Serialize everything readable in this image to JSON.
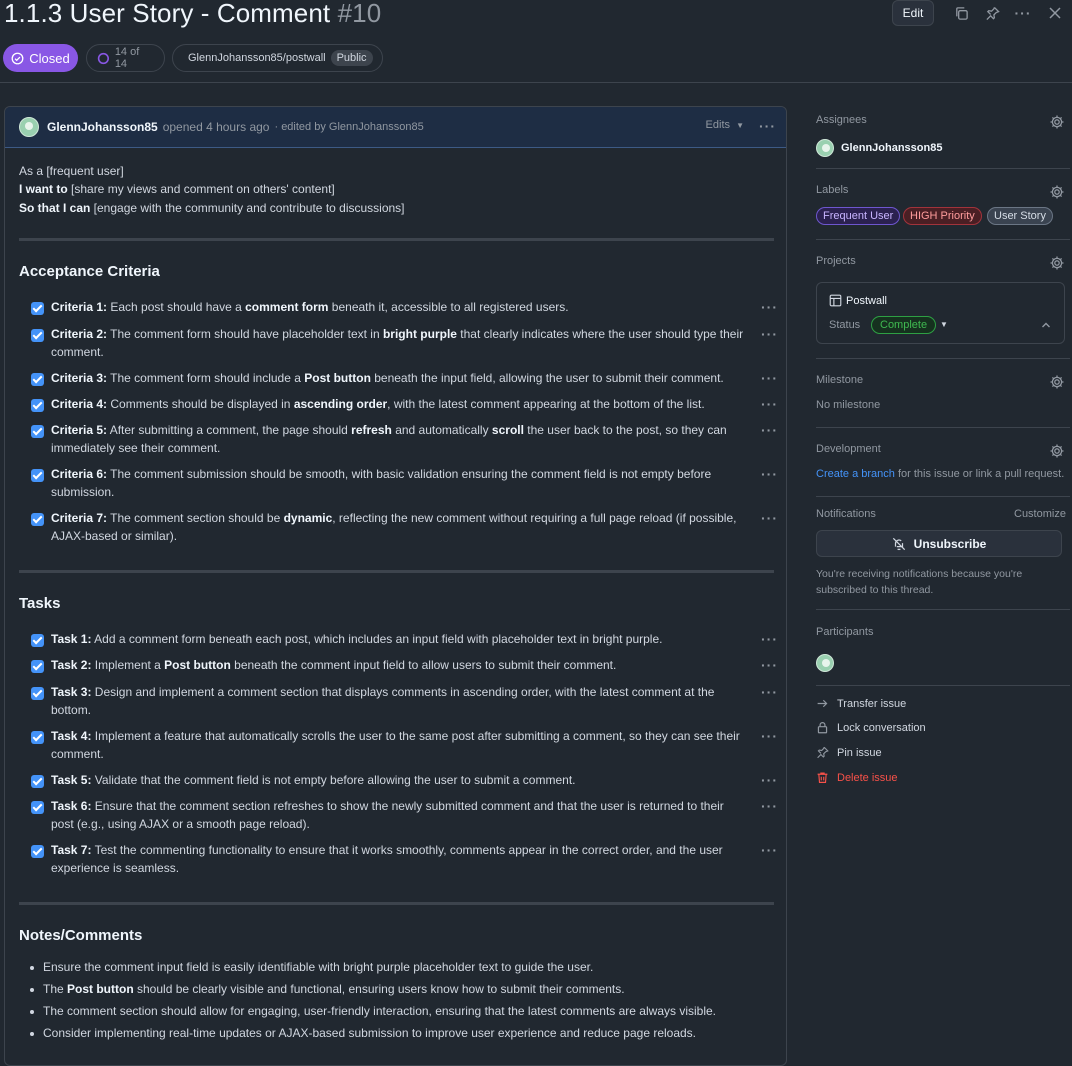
{
  "issue": {
    "title": "1.1.3 User Story - Comment",
    "number": "#10",
    "edit_label": "Edit",
    "state": "Closed",
    "progress": "14 of 14",
    "repo": "GlennJohansson85/postwall",
    "visibility": "Public"
  },
  "comment": {
    "author": "GlennJohansson85",
    "action": "opened 4 hours ago",
    "edited": "· edited by GlennJohansson85",
    "edits_label": "Edits",
    "story": [
      {
        "bold": "",
        "text": "As a [frequent user]"
      },
      {
        "bold": "I want to",
        "text": " [share my views and comment on others' content]"
      },
      {
        "bold": "So that I can",
        "text": " [engage with the community and contribute to discussions]"
      }
    ],
    "acceptance_heading": "Acceptance Criteria",
    "criteria": [
      {
        "segments": [
          [
            "b",
            "Criteria 1:"
          ],
          [
            "t",
            " Each post should have a "
          ],
          [
            "b",
            "comment form"
          ],
          [
            "t",
            " beneath it, accessible to all registered users."
          ]
        ]
      },
      {
        "segments": [
          [
            "b",
            "Criteria 2:"
          ],
          [
            "t",
            " The comment form should have placeholder text in "
          ],
          [
            "b",
            "bright purple"
          ],
          [
            "t",
            " that clearly indicates where the user should type their comment."
          ]
        ]
      },
      {
        "segments": [
          [
            "b",
            "Criteria 3:"
          ],
          [
            "t",
            " The comment form should include a "
          ],
          [
            "b",
            "Post button"
          ],
          [
            "t",
            " beneath the input field, allowing the user to submit their comment."
          ]
        ]
      },
      {
        "segments": [
          [
            "b",
            "Criteria 4:"
          ],
          [
            "t",
            " Comments should be displayed in "
          ],
          [
            "b",
            "ascending order"
          ],
          [
            "t",
            ", with the latest comment appearing at the bottom of the list."
          ]
        ]
      },
      {
        "segments": [
          [
            "b",
            "Criteria 5:"
          ],
          [
            "t",
            " After submitting a comment, the page should "
          ],
          [
            "b",
            "refresh"
          ],
          [
            "t",
            " and automatically "
          ],
          [
            "b",
            "scroll"
          ],
          [
            "t",
            " the user back to the post, so they can immediately see their comment."
          ]
        ]
      },
      {
        "segments": [
          [
            "b",
            "Criteria 6:"
          ],
          [
            "t",
            " The comment submission should be smooth, with basic validation ensuring the comment field is not empty before submission."
          ]
        ]
      },
      {
        "segments": [
          [
            "b",
            "Criteria 7:"
          ],
          [
            "t",
            " The comment section should be "
          ],
          [
            "b",
            "dynamic"
          ],
          [
            "t",
            ", reflecting the new comment without requiring a full page reload (if possible, AJAX-based or similar)."
          ]
        ]
      }
    ],
    "tasks_heading": "Tasks",
    "tasks": [
      {
        "segments": [
          [
            "b",
            "Task 1:"
          ],
          [
            "t",
            " Add a comment form beneath each post, which includes an input field with placeholder text in bright purple."
          ]
        ]
      },
      {
        "segments": [
          [
            "b",
            "Task 2:"
          ],
          [
            "t",
            " Implement a "
          ],
          [
            "b",
            "Post button"
          ],
          [
            "t",
            " beneath the comment input field to allow users to submit their comment."
          ]
        ]
      },
      {
        "segments": [
          [
            "b",
            "Task 3:"
          ],
          [
            "t",
            " Design and implement a comment section that displays comments in ascending order, with the latest comment at the bottom."
          ]
        ]
      },
      {
        "segments": [
          [
            "b",
            "Task 4:"
          ],
          [
            "t",
            " Implement a feature that automatically scrolls the user to the same post after submitting a comment, so they can see their comment."
          ]
        ]
      },
      {
        "segments": [
          [
            "b",
            "Task 5:"
          ],
          [
            "t",
            " Validate that the comment field is not empty before allowing the user to submit a comment."
          ]
        ]
      },
      {
        "segments": [
          [
            "b",
            "Task 6:"
          ],
          [
            "t",
            " Ensure that the comment section refreshes to show the newly submitted comment and that the user is returned to their post (e.g., using AJAX or a smooth page reload)."
          ]
        ]
      },
      {
        "segments": [
          [
            "b",
            "Task 7:"
          ],
          [
            "t",
            " Test the commenting functionality to ensure that it works smoothly, comments appear in the correct order, and the user experience is seamless."
          ]
        ]
      }
    ],
    "notes_heading": "Notes/Comments",
    "notes": [
      {
        "segments": [
          [
            "t",
            "Ensure the comment input field is easily identifiable with bright purple placeholder text to guide the user."
          ]
        ]
      },
      {
        "segments": [
          [
            "t",
            "The "
          ],
          [
            "b",
            "Post button"
          ],
          [
            "t",
            " should be clearly visible and functional, ensuring users know how to submit their comments."
          ]
        ]
      },
      {
        "segments": [
          [
            "t",
            "The comment section should allow for engaging, user-friendly interaction, ensuring that the latest comments are always visible."
          ]
        ]
      },
      {
        "segments": [
          [
            "t",
            "Consider implementing real-time updates or AJAX-based submission to improve user experience and reduce page reloads."
          ]
        ]
      }
    ]
  },
  "sidebar": {
    "assignees_label": "Assignees",
    "assignee": "GlennJohansson85",
    "labels_label": "Labels",
    "labels": [
      {
        "text": "Frequent User",
        "fg": "#c8b4ff",
        "bg": "#2b2150",
        "border": "#6e56cf"
      },
      {
        "text": "HIGH Priority",
        "fg": "#ff9c9c",
        "bg": "#4a1f24",
        "border": "#a2333b"
      },
      {
        "text": "User Story",
        "fg": "#d6dde6",
        "bg": "#3a4350",
        "border": "#6b7685"
      }
    ],
    "projects_label": "Projects",
    "project_name": "Postwall",
    "status_label": "Status",
    "status_value": "Complete",
    "milestone_label": "Milestone",
    "milestone_value": "No milestone",
    "development_label": "Development",
    "dev_link": "Create a branch",
    "dev_text": " for this issue or link a pull request.",
    "notifications_label": "Notifications",
    "customize_label": "Customize",
    "unsubscribe_label": "Unsubscribe",
    "notif_text_1": "You're receiving notifications because you're",
    "notif_text_2": "subscribed to this thread.",
    "participants_label": "Participants",
    "actions": [
      {
        "label": "Transfer issue",
        "icon": "arrow-right-icon"
      },
      {
        "label": "Lock conversation",
        "icon": "lock-icon"
      },
      {
        "label": "Pin issue",
        "icon": "pin-icon"
      },
      {
        "label": "Delete issue",
        "icon": "trash-icon"
      }
    ]
  },
  "colors": {
    "closed_badge": "#8957e5",
    "accent_blue": "#4493f8",
    "danger": "#f85149",
    "success": "#3fb950",
    "background": "#212830"
  }
}
